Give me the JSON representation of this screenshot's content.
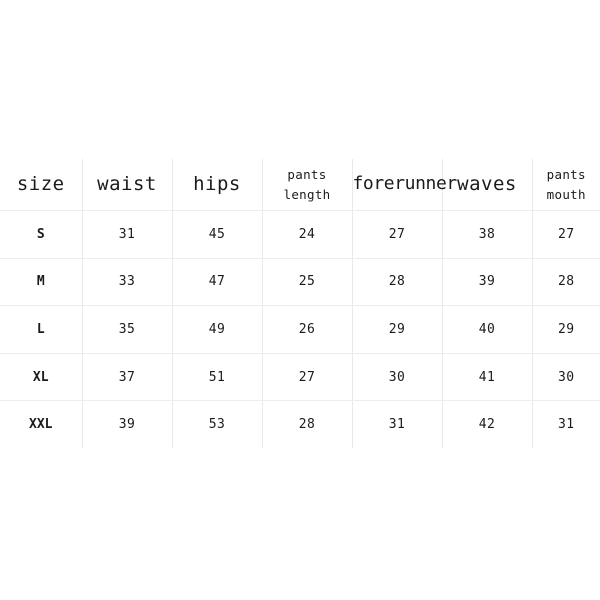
{
  "table": {
    "title": "size",
    "columns": [
      {
        "key": "size",
        "label": "size",
        "lines": [
          "size"
        ],
        "style": "normal"
      },
      {
        "key": "waist",
        "label": "waist",
        "lines": [
          "waist"
        ],
        "style": "normal"
      },
      {
        "key": "hips",
        "label": "hips",
        "lines": [
          "hips"
        ],
        "style": "normal"
      },
      {
        "key": "pants_length",
        "label": "pants length",
        "lines": [
          "pants",
          "length"
        ],
        "style": "small"
      },
      {
        "key": "forerunner",
        "label": "forerunner",
        "lines": [
          "forerunner"
        ],
        "style": "tight"
      },
      {
        "key": "waves",
        "label": "waves",
        "lines": [
          "waves"
        ],
        "style": "normal"
      },
      {
        "key": "pants_mouth",
        "label": "pants mouth",
        "lines": [
          "pants",
          "mouth"
        ],
        "style": "small"
      }
    ],
    "rows": [
      {
        "size": "S",
        "waist": "31",
        "hips": "45",
        "pants_length": "24",
        "forerunner": "27",
        "waves": "38",
        "pants_mouth": "27"
      },
      {
        "size": "M",
        "waist": "33",
        "hips": "47",
        "pants_length": "25",
        "forerunner": "28",
        "waves": "39",
        "pants_mouth": "28"
      },
      {
        "size": "L",
        "waist": "35",
        "hips": "49",
        "pants_length": "26",
        "forerunner": "29",
        "waves": "40",
        "pants_mouth": "29"
      },
      {
        "size": "XL",
        "waist": "37",
        "hips": "51",
        "pants_length": "27",
        "forerunner": "30",
        "waves": "41",
        "pants_mouth": "30"
      },
      {
        "size": "XXL",
        "waist": "39",
        "hips": "53",
        "pants_length": "28",
        "forerunner": "31",
        "waves": "42",
        "pants_mouth": "31"
      }
    ]
  },
  "colors": {
    "background": "#ffffff",
    "text": "#1b1b1b",
    "border_vertical": "#e9e9e9",
    "border_horizontal": "#ededed"
  }
}
